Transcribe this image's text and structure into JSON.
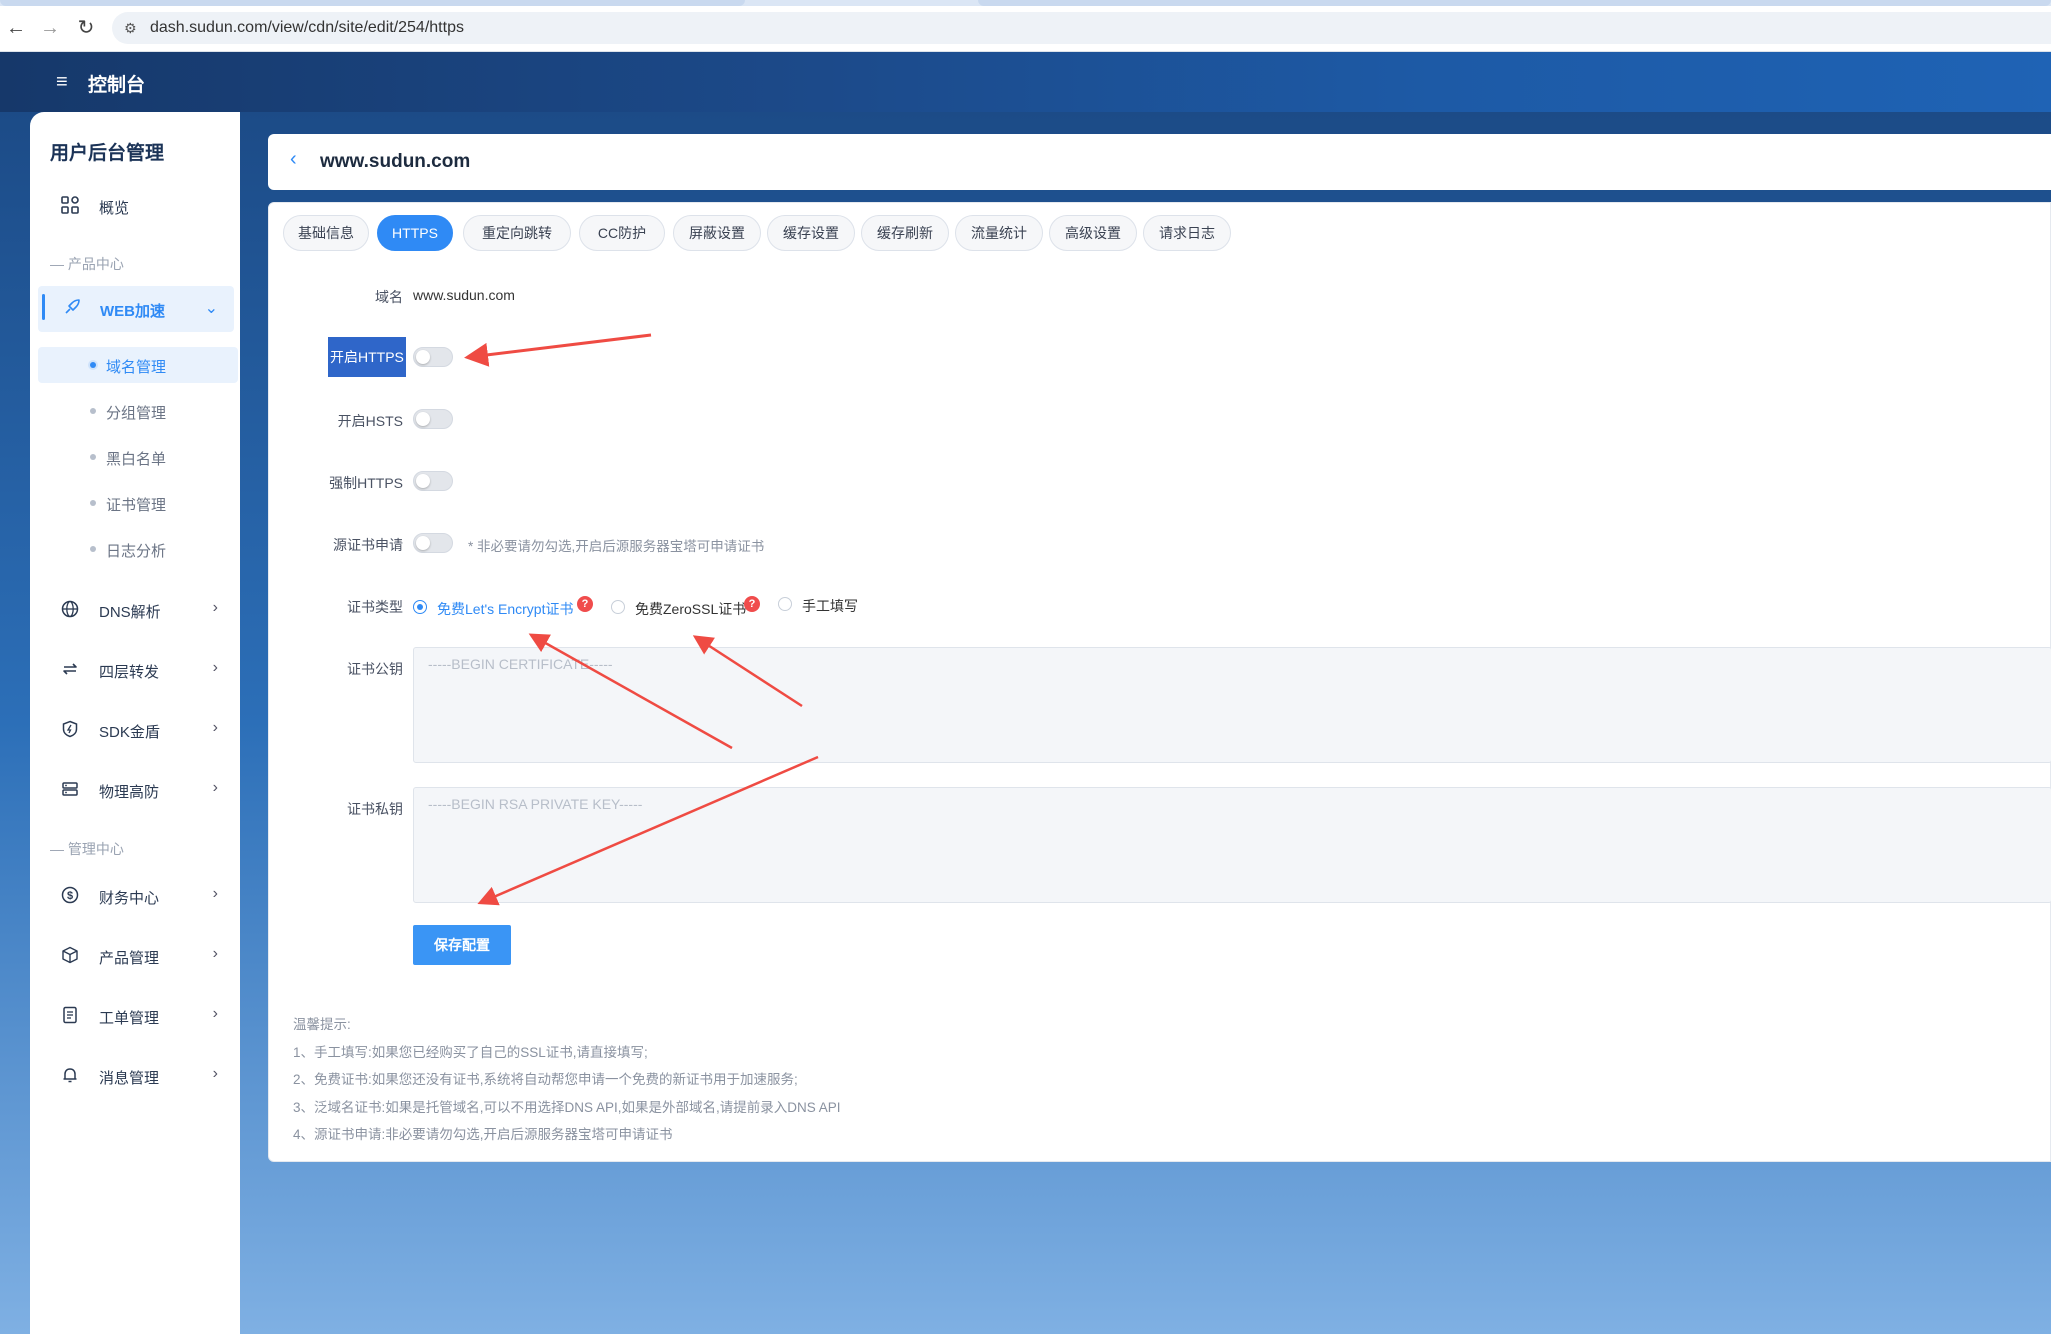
{
  "browser": {
    "url": "dash.sudun.com/view/cdn/site/edit/254/https",
    "back_glyph": "←",
    "forward_glyph": "→",
    "reload_glyph": "↻",
    "site_glyph": "⚙"
  },
  "header": {
    "title": "控制台",
    "menu_glyph": "≡"
  },
  "sidebar": {
    "heading": "用户后台管理",
    "overview": "概览",
    "section_product": "— 产品中心",
    "web": "WEB加速",
    "sub_items": [
      "域名管理",
      "分组管理",
      "黑白名单",
      "证书管理",
      "日志分析"
    ],
    "dns": "DNS解析",
    "l4": "四层转发",
    "sdk": "SDK金盾",
    "physical": "物理高防",
    "section_manage": "— 管理中心",
    "finance": "财务中心",
    "product_mgmt": "产品管理",
    "ticket": "工单管理",
    "message": "消息管理",
    "chevron": "›",
    "chevron_down": "⌄"
  },
  "main": {
    "back_glyph": "‹",
    "domain_title": "www.sudun.com",
    "tabs": [
      "基础信息",
      "HTTPS",
      "重定向跳转",
      "CC防护",
      "屏蔽设置",
      "缓存设置",
      "缓存刷新",
      "流量统计",
      "高级设置",
      "请求日志"
    ],
    "active_tab": "HTTPS"
  },
  "form": {
    "domain_label": "域名",
    "domain_value": "www.sudun.com",
    "https_label": "开启HTTPS",
    "https_on": false,
    "hsts_label": "开启HSTS",
    "hsts_on": false,
    "force_label": "强制HTTPS",
    "force_on": false,
    "origin_label": "源证书申请",
    "origin_on": false,
    "origin_hint": "* 非必要请勿勾选,开启后源服务器宝塔可申请证书",
    "cert_type_label": "证书类型",
    "cert_options": [
      "免费Let's Encrypt证书",
      "免费ZeroSSL证书",
      "手工填写"
    ],
    "cert_selected": "免费Let's Encrypt证书",
    "help_glyph": "?",
    "pubkey_label": "证书公钥",
    "pubkey_placeholder": "-----BEGIN CERTIFICATE-----",
    "privkey_label": "证书私钥",
    "privkey_placeholder": "-----BEGIN RSA PRIVATE KEY-----",
    "save_button": "保存配置"
  },
  "tips": {
    "title": "温馨提示:",
    "lines": [
      "1、手工填写:如果您已经购买了自己的SSL证书,请直接填写;",
      "2、免费证书:如果您还没有证书,系统将自动帮您申请一个免费的新证书用于加速服务;",
      "3、泛域名证书:如果是托管域名,可以不用选择DNS API,如果是外部域名,请提前录入DNS API",
      "4、源证书申请:非必要请勿勾选,开启后源服务器宝塔可申请证书"
    ]
  },
  "colors": {
    "accent": "#2f8af5",
    "header": "#1c4a8a",
    "annotation_arrow": "#ef4b43"
  }
}
